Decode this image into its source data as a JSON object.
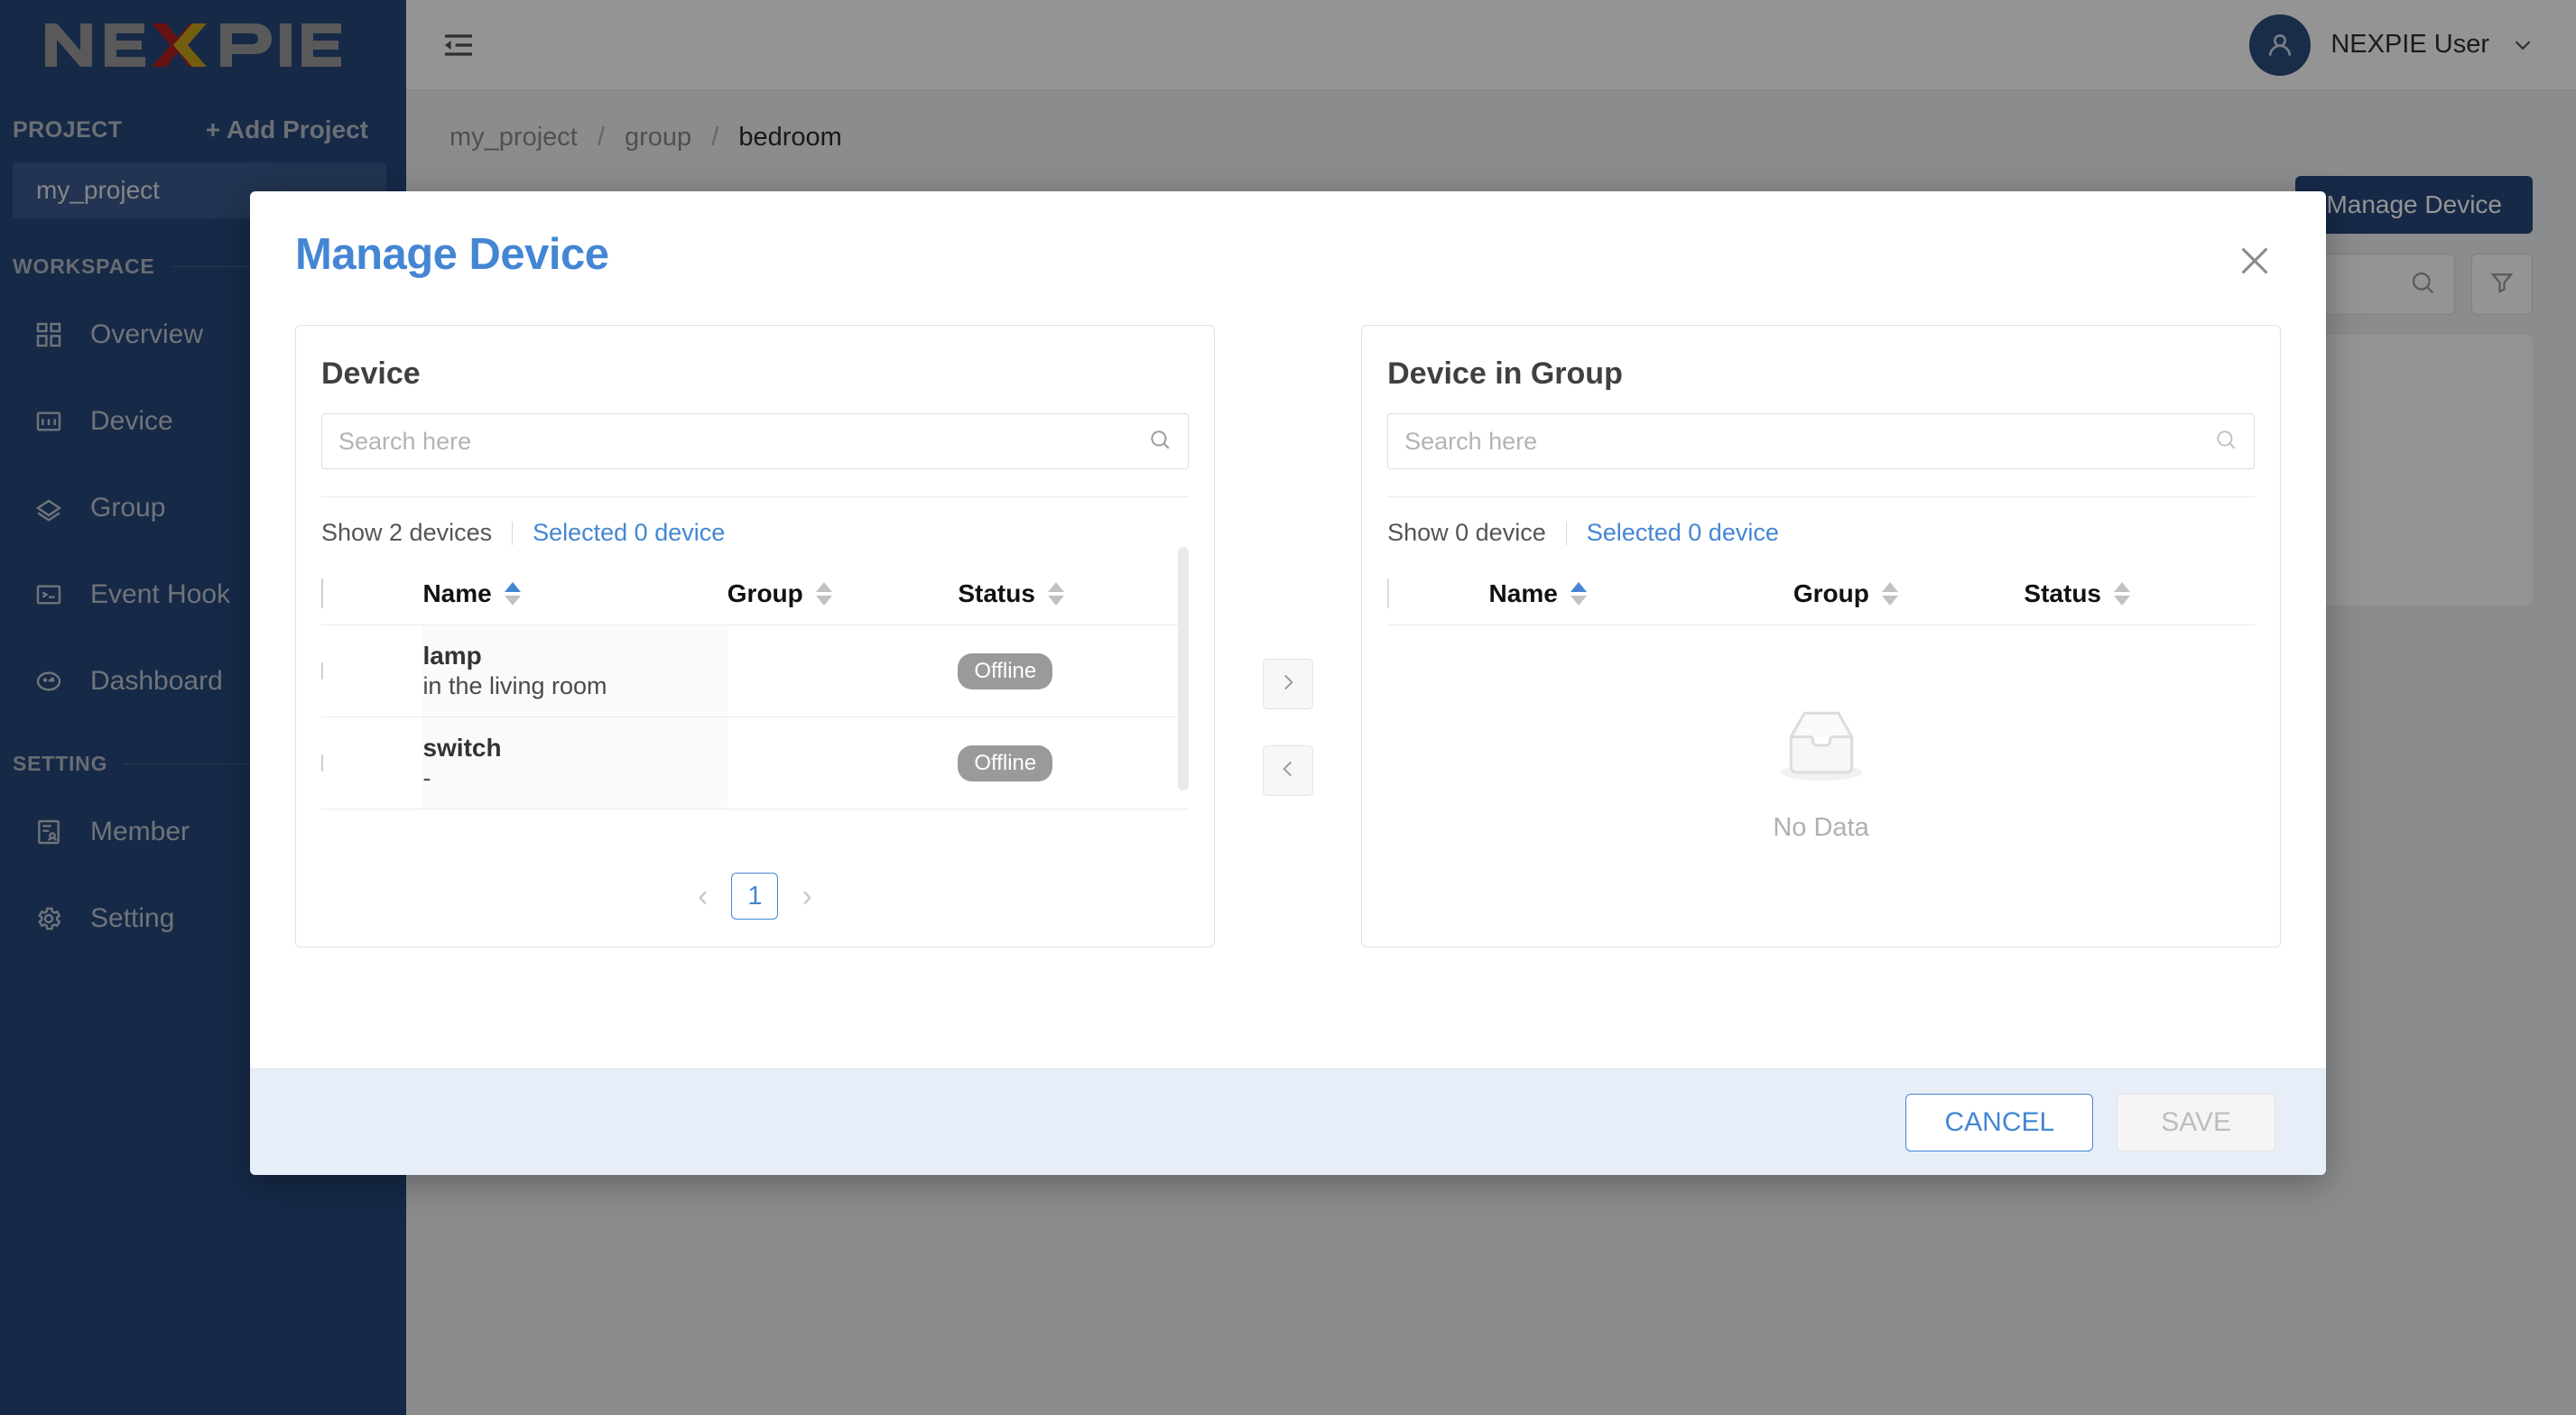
{
  "brand": {
    "logo_text": "NEXPIE",
    "accent_red": "#b0201f",
    "accent_yellow": "#c9a21c",
    "sidebar_bg": "#26477a"
  },
  "sidebar": {
    "project_label": "PROJECT",
    "add_project_label": "+ Add Project",
    "current_project": "my_project",
    "workspace_label": "WORKSPACE",
    "setting_label": "SETTING",
    "workspace_items": [
      {
        "label": "Overview",
        "icon": "grid-icon"
      },
      {
        "label": "Device",
        "icon": "device-icon"
      },
      {
        "label": "Group",
        "icon": "tag-icon"
      },
      {
        "label": "Event Hook",
        "icon": "console-icon"
      },
      {
        "label": "Dashboard",
        "icon": "gauge-icon"
      }
    ],
    "setting_items": [
      {
        "label": "Member",
        "icon": "member-icon"
      },
      {
        "label": "Setting",
        "icon": "gear-icon"
      }
    ]
  },
  "topbar": {
    "fold_icon": "menu-fold-icon",
    "user_name": "NEXPIE User",
    "avatar_icon": "user-icon",
    "chevron": "chevron-down-icon"
  },
  "background": {
    "breadcrumb": [
      "my_project",
      "group",
      "bedroom"
    ],
    "breadcrumb_sep": "/",
    "manage_device_button": "Manage Device",
    "search_icon": "search-icon",
    "filter_icon": "filter-icon"
  },
  "modal": {
    "title": "Manage Device",
    "close_icon": "close-icon",
    "left_panel": {
      "title": "Device",
      "search_placeholder": "Search here",
      "search_icon": "search-icon",
      "show_count_label": "Show 2 devices",
      "selected_label": "Selected 0 device",
      "columns": [
        "Name",
        "Group",
        "Status"
      ],
      "sort_state": [
        "asc",
        "none",
        "none"
      ],
      "rows": [
        {
          "name": "lamp",
          "desc": "in the living room",
          "group": "",
          "status": "Offline"
        },
        {
          "name": "switch",
          "desc": "-",
          "group": "",
          "status": "Offline"
        }
      ],
      "pagination": {
        "prev": "‹",
        "page": "1",
        "next": "›"
      }
    },
    "transfer": {
      "to_right": "›",
      "to_left": "‹"
    },
    "right_panel": {
      "title": "Device in Group",
      "search_placeholder": "Search here",
      "search_icon": "search-icon",
      "show_count_label": "Show 0 device",
      "selected_label": "Selected 0 device",
      "columns": [
        "Name",
        "Group",
        "Status"
      ],
      "sort_state": [
        "asc",
        "none",
        "none"
      ],
      "rows": [],
      "empty_label": "No Data",
      "empty_icon": "empty-inbox-icon"
    },
    "footer": {
      "cancel_label": "CANCEL",
      "save_label": "SAVE",
      "save_disabled": true
    }
  }
}
